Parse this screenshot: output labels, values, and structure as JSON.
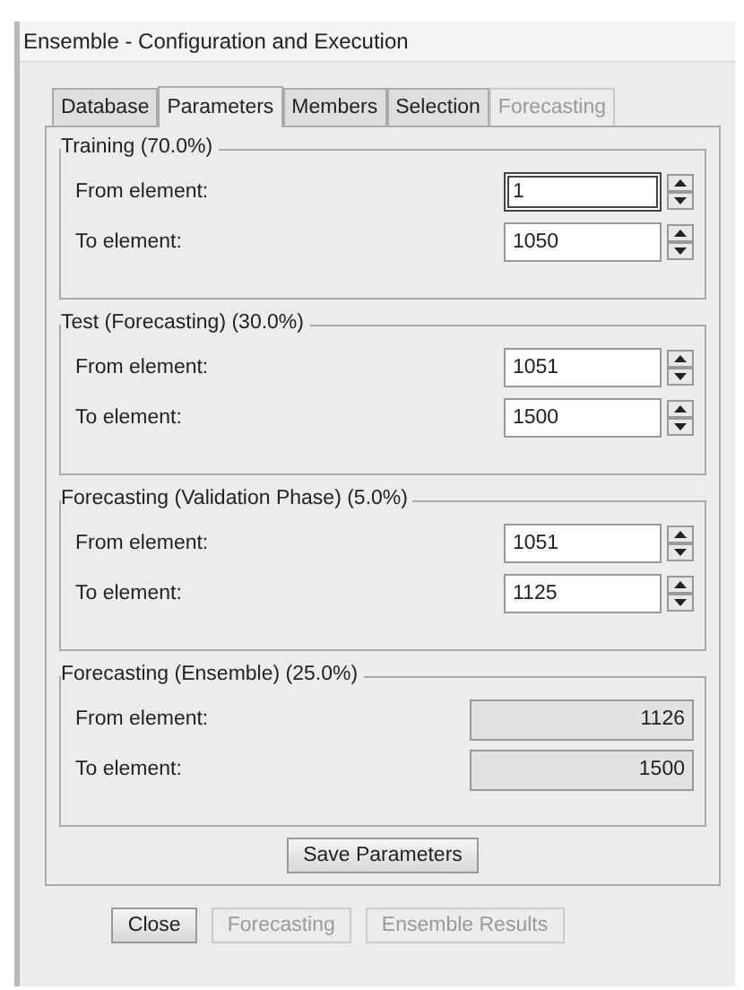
{
  "window": {
    "title": "Ensemble - Configuration and Execution"
  },
  "tabs": [
    {
      "label": "Database",
      "selected": false,
      "disabled": false
    },
    {
      "label": "Parameters",
      "selected": true,
      "disabled": false
    },
    {
      "label": "Members",
      "selected": false,
      "disabled": false
    },
    {
      "label": "Selection",
      "selected": false,
      "disabled": false
    },
    {
      "label": "Forecasting",
      "selected": false,
      "disabled": true
    }
  ],
  "groups": [
    {
      "title": "Training (70.0%)",
      "fields": [
        {
          "label": "From element:",
          "value": "1",
          "kind": "spinner",
          "focused": true
        },
        {
          "label": "To element:",
          "value": "1050",
          "kind": "spinner",
          "focused": false
        }
      ]
    },
    {
      "title": "Test (Forecasting) (30.0%)",
      "fields": [
        {
          "label": "From element:",
          "value": "1051",
          "kind": "spinner",
          "focused": false
        },
        {
          "label": "To element:",
          "value": "1500",
          "kind": "spinner",
          "focused": false
        }
      ]
    },
    {
      "title": "Forecasting (Validation Phase) (5.0%)",
      "fields": [
        {
          "label": "From element:",
          "value": "1051",
          "kind": "spinner",
          "focused": false
        },
        {
          "label": "To element:",
          "value": "1125",
          "kind": "spinner",
          "focused": false
        }
      ]
    },
    {
      "title": "Forecasting (Ensemble) (25.0%)",
      "fields": [
        {
          "label": "From element:",
          "value": "1126",
          "kind": "readonly",
          "focused": false
        },
        {
          "label": "To element:",
          "value": "1500",
          "kind": "readonly",
          "focused": false
        }
      ]
    }
  ],
  "save_button": "Save Parameters",
  "buttons": [
    {
      "label": "Close",
      "disabled": false
    },
    {
      "label": "Forecasting",
      "disabled": true
    },
    {
      "label": "Ensemble Results",
      "disabled": true
    }
  ]
}
